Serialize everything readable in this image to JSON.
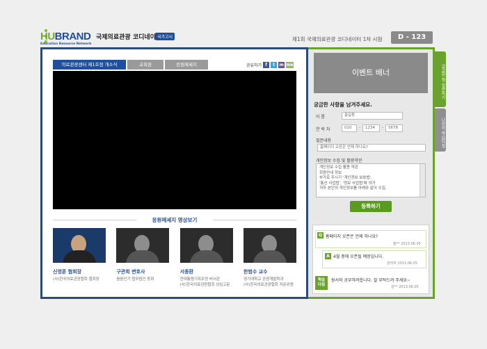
{
  "header": {
    "logo_hu": "HU",
    "logo_brand": "BRAND",
    "logo_sub": "Education Resource Network",
    "site_title": "국제의료관광 코디네이터",
    "site_badge": "국가고시",
    "exam_title": "제1회 국제의료관광 코디네이터 1차 시험",
    "dday": "D - 123"
  },
  "tabs": [
    {
      "label": "의료관광센터 제1호점 개소식"
    },
    {
      "label": "교육원"
    },
    {
      "label": "응원메세지"
    }
  ],
  "share": {
    "label": "공유하기",
    "icons": [
      "f",
      "t",
      "m",
      "me"
    ]
  },
  "messages": {
    "title": "응원메세지 영상보기",
    "people": [
      {
        "name": "신영훈 협회장",
        "org": "(사)한국의료관광협회 협회장"
      },
      {
        "name": "구관회 변호사",
        "org": "음음인기 법무법인 동화"
      },
      {
        "name": "서종환",
        "org": "전대통령기획조정 비서관\n(사)한국의료관련협회 상임고문"
      },
      {
        "name": "한범수 교수",
        "org": "경기대학교 관광개발학과\n(사)한국의료관광협회 자문위원"
      }
    ]
  },
  "right": {
    "banner": "이벤트 배너",
    "form_title": "궁금한 사항을 남겨주세요.",
    "name_label": "이    름",
    "name_value": "홍길동",
    "phone_label": "연 락 처",
    "phone1": "010",
    "phone2": "1234",
    "phone3": "5678",
    "question_label": "질문내용",
    "question_value": "홈페이지 오픈은 언제 하나요?",
    "privacy_label": "개인정보 수집 및 활용약관",
    "privacy_text": "개인정보 수집 활용 약관\n 회원안내 정보\n 부가로 주시기 '개인정보 보호법',\n '통신 사업법', '정보 사업법'에 의거\n 귀하 본인의 개인정보를 아래와 같이 수집,",
    "submit": "등록하기",
    "qa": [
      {
        "badge": "Q",
        "question": "홈페이지 오픈은 언제 하나요?",
        "meta": "홍** 2013.06.05"
      },
      {
        "badge": "A",
        "question": "4월 중에 오픈될 예정입니다.",
        "meta": "관리자 2013.06.05"
      }
    ],
    "study_badge": "학습\n다짐",
    "study_text": "원서와 공부하려합니다. 잘 부탁드려 주세요~",
    "study_meta": "김** 2013.06.05"
  },
  "side_tabs": [
    "궁금한 점 질문하기",
    "나만의 학습다짐"
  ]
}
